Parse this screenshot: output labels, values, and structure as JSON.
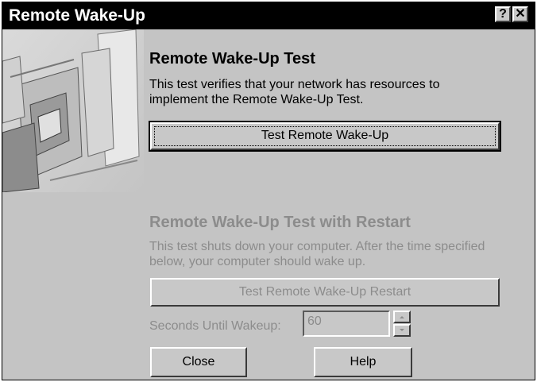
{
  "window": {
    "title": "Remote Wake-Up",
    "help_glyph": "?",
    "close_glyph": "✕"
  },
  "section1": {
    "heading": "Remote Wake-Up Test",
    "description": "This test verifies that your network has resources to implement the Remote Wake-Up Test.",
    "button_label": "Test Remote Wake-Up"
  },
  "section2": {
    "heading": "Remote Wake-Up Test with Restart",
    "description": "This test shuts down your computer.  After the time specified below, your computer should wake up.",
    "button_label": "Test Remote Wake-Up Restart",
    "seconds_label": "Seconds Until Wakeup:",
    "seconds_value": "60"
  },
  "footer": {
    "close_label": "Close",
    "help_label": "Help"
  },
  "colors": {
    "background": "#c4c4c4",
    "titlebar": "#000000",
    "disabled_text": "#8c8c8c"
  },
  "icons": [
    "help-icon",
    "close-icon",
    "spin-up-icon",
    "spin-down-icon",
    "network-illustration"
  ]
}
